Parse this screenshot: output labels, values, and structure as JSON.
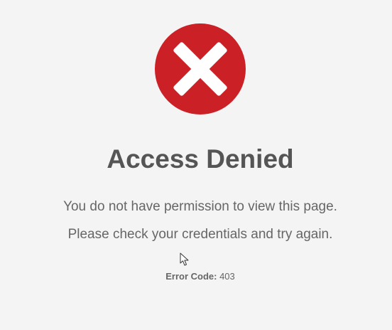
{
  "icons": {
    "error": "close-x-icon",
    "cursor": "mouse-pointer-icon"
  },
  "colors": {
    "error_red": "#cc2027",
    "background": "#f4f4f4",
    "title_text": "#555555",
    "body_text": "#666666"
  },
  "main": {
    "title": "Access Denied",
    "message_line_1": "You do not have permission to view this page.",
    "message_line_2": "Please check your credentials and try again.",
    "error_code_label": "Error Code:",
    "error_code_value": "403"
  }
}
